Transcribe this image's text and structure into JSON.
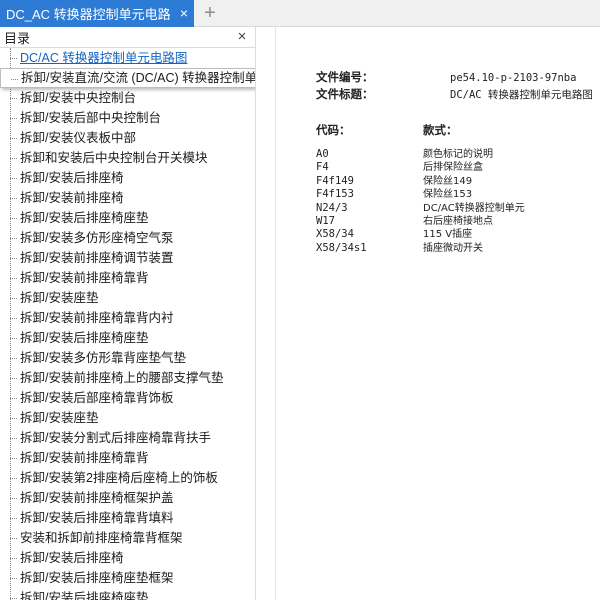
{
  "tab": {
    "title": "DC_AC 转换器控制单元电路图",
    "close_glyph": "×",
    "add_glyph": "+"
  },
  "sidebar": {
    "title": "目录",
    "close_glyph": "×",
    "items": [
      {
        "label": "DC/AC 转换器控制单元电路图"
      },
      {
        "label": "拆卸/安装直流/交流 (DC/AC) 转换器控制单元"
      },
      {
        "label": "拆卸/安装中央控制台"
      },
      {
        "label": "拆卸/安装后部中央控制台"
      },
      {
        "label": "拆卸/安装仪表板中部"
      },
      {
        "label": "拆卸和安装后中央控制台开关模块"
      },
      {
        "label": "拆卸/安装后排座椅"
      },
      {
        "label": "拆卸/安装前排座椅"
      },
      {
        "label": "拆卸/安装后排座椅座垫"
      },
      {
        "label": "拆卸/安装多仿形座椅空气泵"
      },
      {
        "label": "拆卸/安装前排座椅调节装置"
      },
      {
        "label": "拆卸/安装前排座椅靠背"
      },
      {
        "label": "拆卸/安装座垫"
      },
      {
        "label": "拆卸/安装前排座椅靠背内衬"
      },
      {
        "label": "拆卸/安装后排座椅座垫"
      },
      {
        "label": "拆卸/安装多仿形靠背座垫气垫"
      },
      {
        "label": "拆卸/安装前排座椅上的腰部支撑气垫"
      },
      {
        "label": "拆卸/安装后部座椅靠背饰板"
      },
      {
        "label": "拆卸/安装座垫"
      },
      {
        "label": "拆卸/安装分割式后排座椅靠背扶手"
      },
      {
        "label": "拆卸/安装前排座椅靠背"
      },
      {
        "label": "拆卸/安装第2排座椅后座椅上的饰板"
      },
      {
        "label": "拆卸/安装前排座椅框架护盖"
      },
      {
        "label": "拆卸/安装后排座椅靠背填料"
      },
      {
        "label": "安装和拆卸前排座椅靠背框架"
      },
      {
        "label": "拆卸/安装后排座椅"
      },
      {
        "label": "拆卸/安装后排座椅座垫框架"
      },
      {
        "label": "拆卸/安装后排座椅座垫"
      }
    ]
  },
  "document": {
    "file_number_label": "文件编号：",
    "file_number_value": "pe54.10-p-2103-97nba",
    "file_title_label": "文件标题：",
    "file_title_value": "DC/AC 转换器控制单元电路图",
    "code_header": "代码：",
    "desc_header": "款式：",
    "rows": [
      {
        "code": "A0",
        "desc": "颜色标记的说明"
      },
      {
        "code": "F4",
        "desc": "后排保险丝盒"
      },
      {
        "code": "F4f149",
        "desc": "保险丝149"
      },
      {
        "code": "F4f153",
        "desc": "保险丝153"
      },
      {
        "code": "N24/3",
        "desc": "DC/AC转换器控制单元"
      },
      {
        "code": "W17",
        "desc": "右后座椅接地点"
      },
      {
        "code": "X58/34",
        "desc": "115 V插座"
      },
      {
        "code": "X58/34s1",
        "desc": "插座微动开关"
      }
    ]
  }
}
